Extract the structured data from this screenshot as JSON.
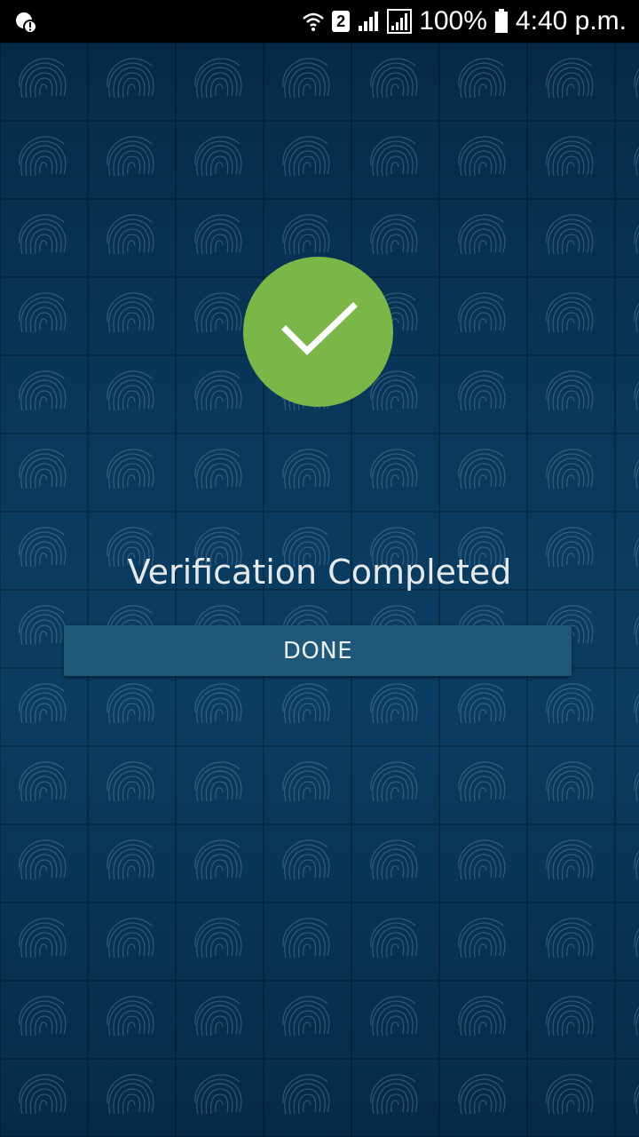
{
  "status_bar": {
    "sim_slot": "2",
    "battery": "100%",
    "time": "4:40 p.m."
  },
  "main": {
    "title": "Verification Completed",
    "done_label": "DONE"
  },
  "colors": {
    "background": "#062a45",
    "success": "#7ab648",
    "button": "#1f5778",
    "text": "#e6e9ec"
  },
  "icons": [
    "alert-icon",
    "wifi-icon",
    "sim-icon",
    "signal-icon",
    "battery-icon",
    "checkmark-icon",
    "fingerprint-icon"
  ]
}
